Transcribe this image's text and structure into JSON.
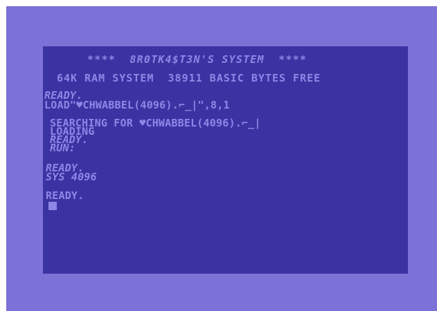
{
  "screen": {
    "banner": "****  8R0TK4$T3N'S SYSTEM  ****",
    "memory": "64K RAM SYSTEM  38911 BASIC BYTES FREE",
    "ready_1": "READY.",
    "load_cmd": "LOAD\"♥CHWABBEL(4096).⌐_|\",8,1",
    "searching": "SEARCHING FOR ♥CHWABBEL(4096).⌐_|",
    "loading": "LOADING",
    "ready_2": "READY.",
    "run": "RUN:",
    "ready_3": "READY.",
    "sys_cmd": "SYS 4096",
    "ready_4": "READY."
  },
  "colors": {
    "border": "#7b71d6",
    "background": "#3c33a3",
    "text": "#8e87e6"
  }
}
